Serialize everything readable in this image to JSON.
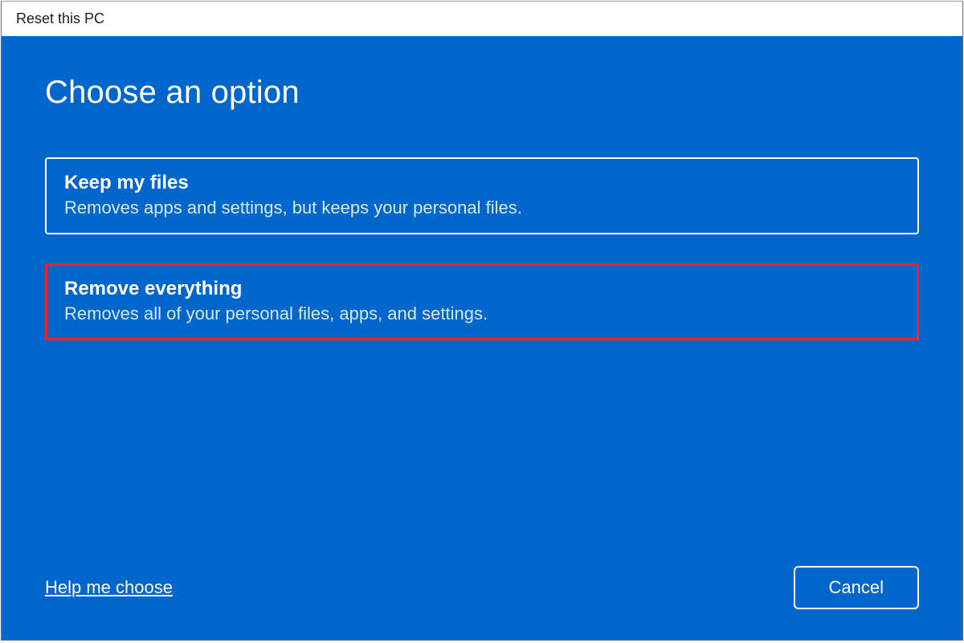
{
  "window": {
    "title": "Reset this PC"
  },
  "main": {
    "heading": "Choose an option",
    "options": [
      {
        "title": "Keep my files",
        "description": "Removes apps and settings, but keeps your personal files.",
        "highlighted": false
      },
      {
        "title": "Remove everything",
        "description": "Removes all of your personal files, apps, and settings.",
        "highlighted": true
      }
    ]
  },
  "footer": {
    "help_link": "Help me choose",
    "cancel_label": "Cancel"
  }
}
